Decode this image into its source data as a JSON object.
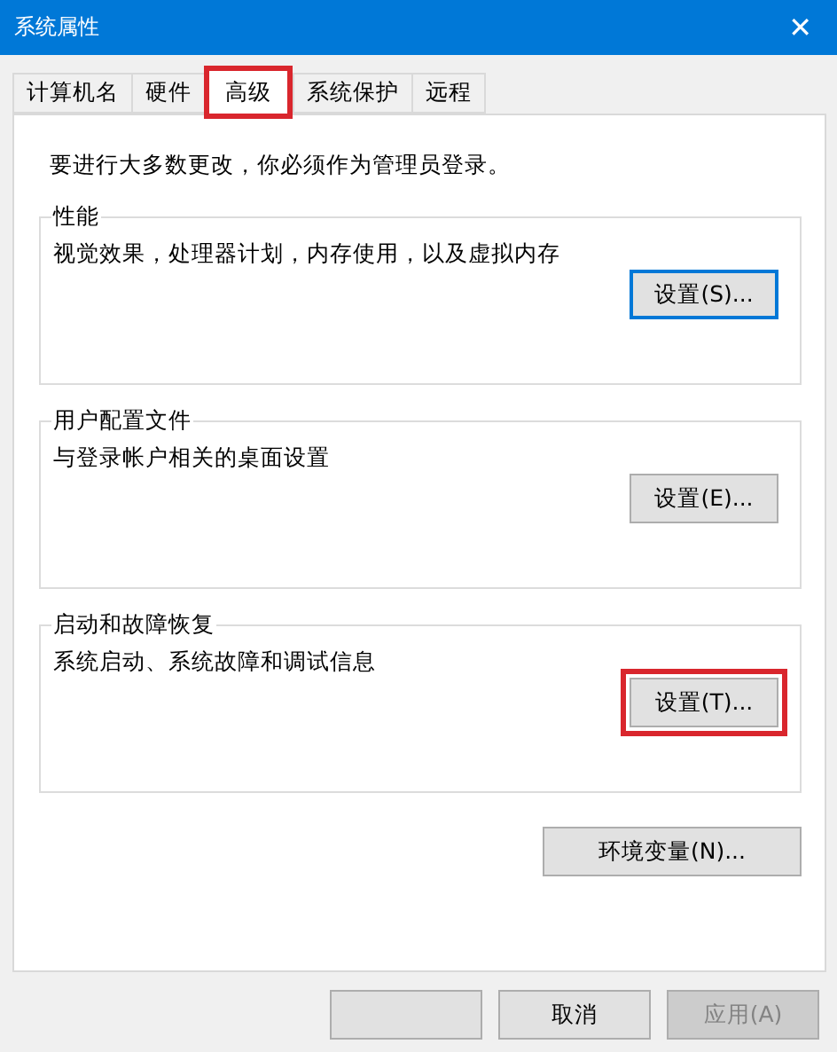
{
  "window": {
    "title": "系统属性",
    "close": "✕"
  },
  "tabs": [
    {
      "label": "计算机名",
      "selected": false,
      "highlighted": false
    },
    {
      "label": "硬件",
      "selected": false,
      "highlighted": false
    },
    {
      "label": "高级",
      "selected": true,
      "highlighted": true
    },
    {
      "label": "系统保护",
      "selected": false,
      "highlighted": false
    },
    {
      "label": "远程",
      "selected": false,
      "highlighted": false
    }
  ],
  "notice": "要进行大多数更改，你必须作为管理员登录。",
  "groups": [
    {
      "title": "性能",
      "description": "视觉效果，处理器计划，内存使用，以及虚拟内存",
      "button": {
        "label": "设置(S)...",
        "focused": true,
        "highlighted": false
      }
    },
    {
      "title": "用户配置文件",
      "description": "与登录帐户相关的桌面设置",
      "button": {
        "label": "设置(E)...",
        "focused": false,
        "highlighted": false
      }
    },
    {
      "title": "启动和故障恢复",
      "description": "系统启动、系统故障和调试信息",
      "button": {
        "label": "设置(T)...",
        "focused": false,
        "highlighted": true
      }
    }
  ],
  "env_button": {
    "label": "环境变量(N)..."
  },
  "dialog_buttons": [
    {
      "disabled": false
    },
    {
      "label": "取消",
      "disabled": false
    },
    {
      "label": "应用(A)",
      "disabled": true
    }
  ]
}
